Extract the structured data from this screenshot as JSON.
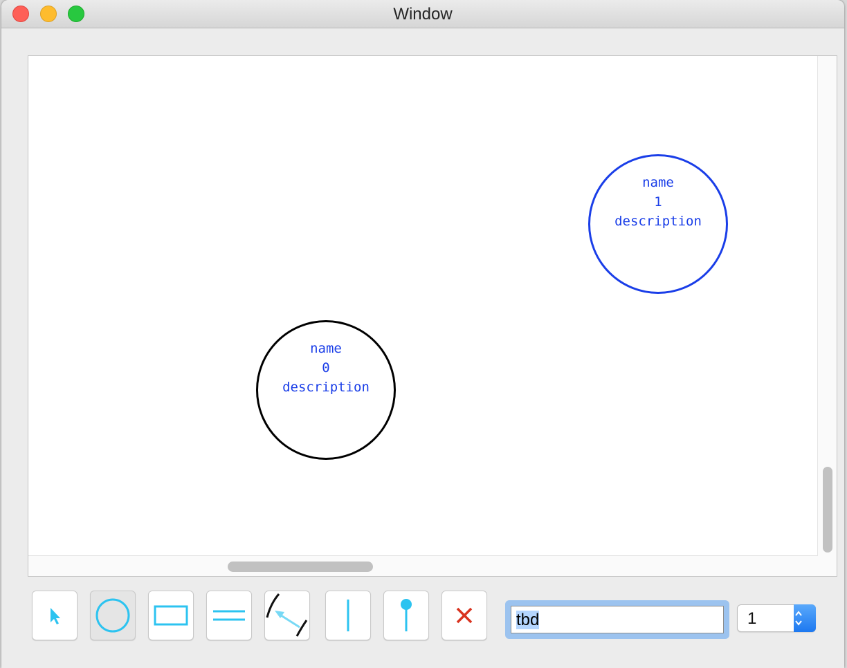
{
  "window": {
    "title": "Window"
  },
  "canvas": {
    "nodes": [
      {
        "name": "name",
        "number": "1",
        "description": "description",
        "selected": true,
        "border_color": "#1a3ee8"
      },
      {
        "name": "name",
        "number": "0",
        "description": "description",
        "selected": false,
        "border_color": "#000000"
      }
    ]
  },
  "toolbar": {
    "tools": [
      {
        "icon": "arrow-pointer-icon",
        "active": false
      },
      {
        "icon": "circle-icon",
        "active": true
      },
      {
        "icon": "rectangle-icon",
        "active": false
      },
      {
        "icon": "parallel-lines-icon",
        "active": false
      },
      {
        "icon": "arc-connector-icon",
        "active": false
      },
      {
        "icon": "vertical-line-icon",
        "active": false
      },
      {
        "icon": "pin-icon",
        "active": false
      },
      {
        "icon": "delete-x-icon",
        "active": false
      }
    ],
    "text_value": "tbd",
    "stepper_value": "1"
  },
  "colors": {
    "tool_accent": "#2cc3f0",
    "node_text": "#1a3ee8",
    "delete": "#d9331f"
  }
}
